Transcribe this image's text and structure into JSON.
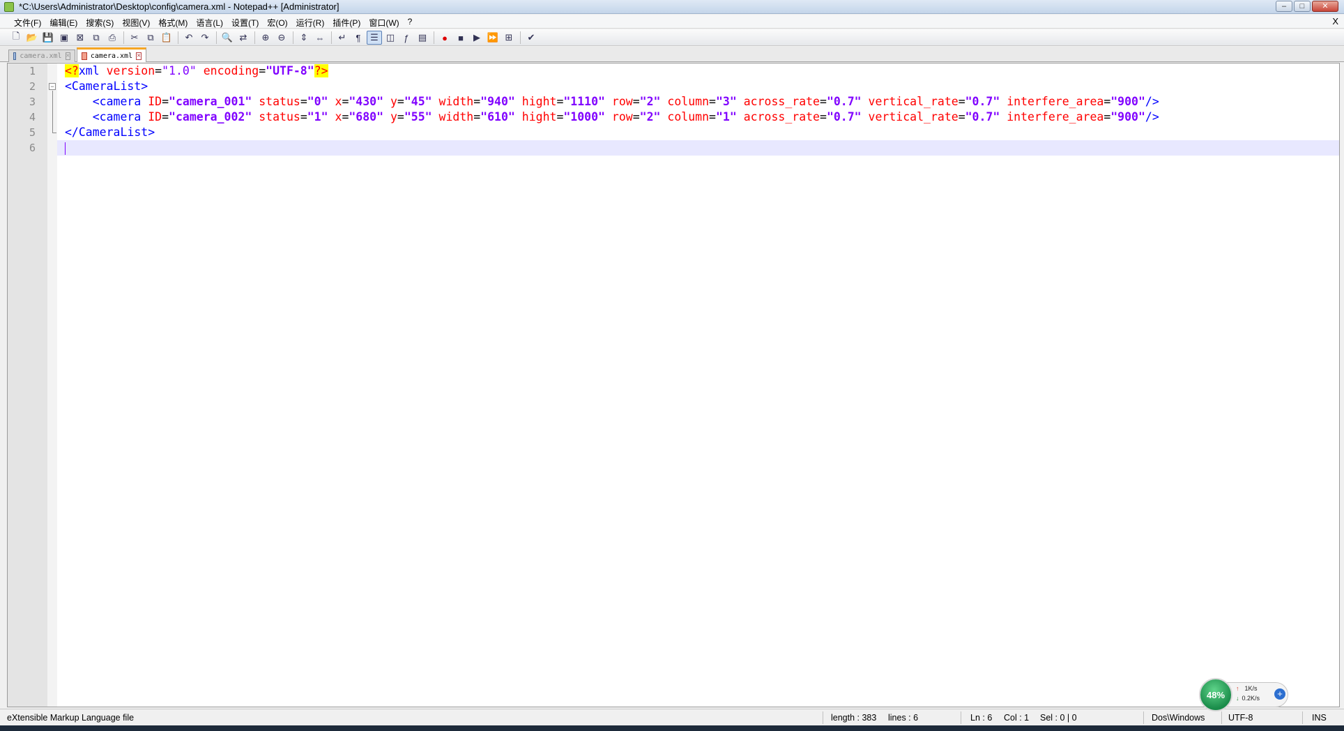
{
  "window": {
    "title": "*C:\\Users\\Administrator\\Desktop\\config\\camera.xml - Notepad++ [Administrator]",
    "minimize_glyph": "–",
    "maximize_glyph": "□",
    "close_glyph": "✕"
  },
  "menubar": {
    "items": [
      "文件(F)",
      "编辑(E)",
      "搜索(S)",
      "视图(V)",
      "格式(M)",
      "语言(L)",
      "设置(T)",
      "宏(O)",
      "运行(R)",
      "插件(P)",
      "窗口(W)",
      "?"
    ],
    "close_label": "X"
  },
  "toolbar": {
    "icons": [
      "new-file-icon",
      "open-file-icon",
      "save-icon",
      "save-all-icon",
      "close-icon",
      "close-all-icon",
      "print-icon",
      "cut-icon",
      "copy-icon",
      "paste-icon",
      "undo-icon",
      "redo-icon",
      "find-icon",
      "replace-icon",
      "zoom-in-icon",
      "zoom-out-icon",
      "sync-vertical-icon",
      "sync-horizontal-icon",
      "word-wrap-icon",
      "show-all-chars-icon",
      "indent-guide-icon",
      "user-define-lang-icon",
      "function-list-icon",
      "doc-map-icon",
      "record-macro-icon",
      "stop-macro-icon",
      "play-macro-icon",
      "run-macro-multiple-icon",
      "save-macro-icon",
      "spellcheck-icon"
    ]
  },
  "tabs": [
    {
      "label": "camera.xml",
      "active": false
    },
    {
      "label": "camera.xml",
      "active": true
    }
  ],
  "editor": {
    "line_numbers": [
      "1",
      "2",
      "3",
      "4",
      "5",
      "6"
    ],
    "lines": [
      {
        "text": "<?xml version=\"1.0\" encoding=\"UTF-8\"?>"
      },
      {
        "text": "<CameraList>"
      },
      {
        "text": "    <camera ID=\"camera_001\" status=\"0\" x=\"430\" y=\"45\" width=\"940\" hight=\"1110\" row=\"2\" column=\"3\" across_rate=\"0.7\" vertical_rate=\"0.7\" interfere_area=\"900\"/>"
      },
      {
        "text": "    <camera ID=\"camera_002\" status=\"1\" x=\"680\" y=\"55\" width=\"610\" hight=\"1000\" row=\"2\" column=\"1\" across_rate=\"0.7\" vertical_rate=\"0.7\" interfere_area=\"900\"/>"
      },
      {
        "text": "</CameraList>"
      },
      {
        "text": ""
      }
    ],
    "current_line": 6
  },
  "statusbar": {
    "file_type": "eXtensible Markup Language file",
    "length": "length : 383",
    "lines": "lines : 6",
    "ln": "Ln : 6",
    "col": "Col : 1",
    "sel": "Sel : 0 | 0",
    "eol": "Dos\\Windows",
    "encoding": "UTF-8",
    "mode": "INS"
  },
  "net_monitor": {
    "percent": "48%",
    "upload": "1K/s",
    "download": "0.2K/s",
    "up_arrow": "↑",
    "down_arrow": "↓",
    "plus": "+"
  },
  "colors": {
    "tag": "#0000ff",
    "attribute": "#ff0000",
    "value": "#8000ff",
    "current_line": "#e8e8ff",
    "tab_accent": "#f6a623"
  }
}
